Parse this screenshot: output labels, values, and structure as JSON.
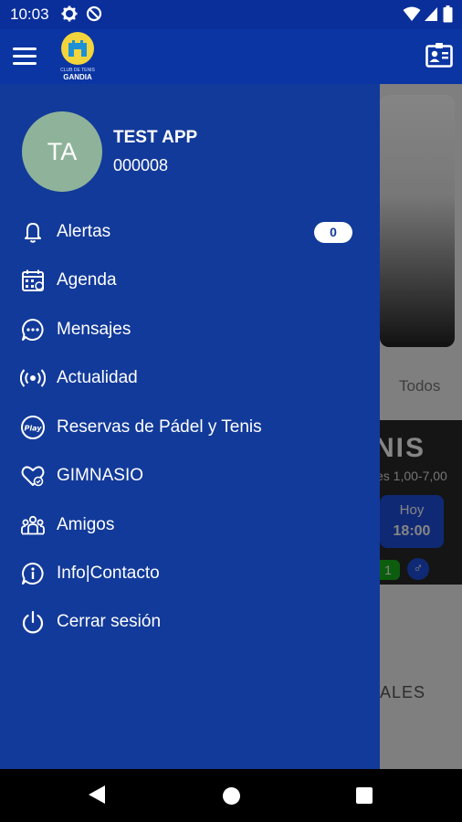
{
  "status_bar": {
    "time": "10:03",
    "left_icons": [
      "gear-icon",
      "no-disturb-icon"
    ],
    "right_icons": [
      "wifi-icon",
      "signal-icon",
      "battery-icon"
    ]
  },
  "app_bar": {
    "logo_line1": "CLUB DE TENIS",
    "logo_line2": "GANDIA"
  },
  "user": {
    "initials": "TA",
    "name": "TEST APP",
    "code": "000008"
  },
  "menu": [
    {
      "label": "Alertas",
      "icon": "bell-icon",
      "badge": "0"
    },
    {
      "label": "Agenda",
      "icon": "calendar-icon"
    },
    {
      "label": "Mensajes",
      "icon": "chat-bubble-icon"
    },
    {
      "label": "Actualidad",
      "icon": "broadcast-icon"
    },
    {
      "label": "Reservas de Pádel y Tenis",
      "icon": "play-icon"
    },
    {
      "label": "GIMNASIO",
      "icon": "heart-icon"
    },
    {
      "label": "Amigos",
      "icon": "group-icon"
    },
    {
      "label": "Info|Contacto",
      "icon": "info-bubble-icon"
    },
    {
      "label": "Cerrar sesión",
      "icon": "power-icon"
    }
  ],
  "background": {
    "tab_todos": "Todos",
    "banner_title": "NIS",
    "banner_sub": "es 1,00-7,00",
    "slot_day": "Hoy",
    "slot_time": "18:00",
    "green_tag": "1",
    "footer_text": "ALES"
  },
  "colors": {
    "drawer": "#123a9a",
    "appbar": "#0a35a3",
    "avatar": "#8fb39a",
    "accent": "#1f4fe0"
  }
}
